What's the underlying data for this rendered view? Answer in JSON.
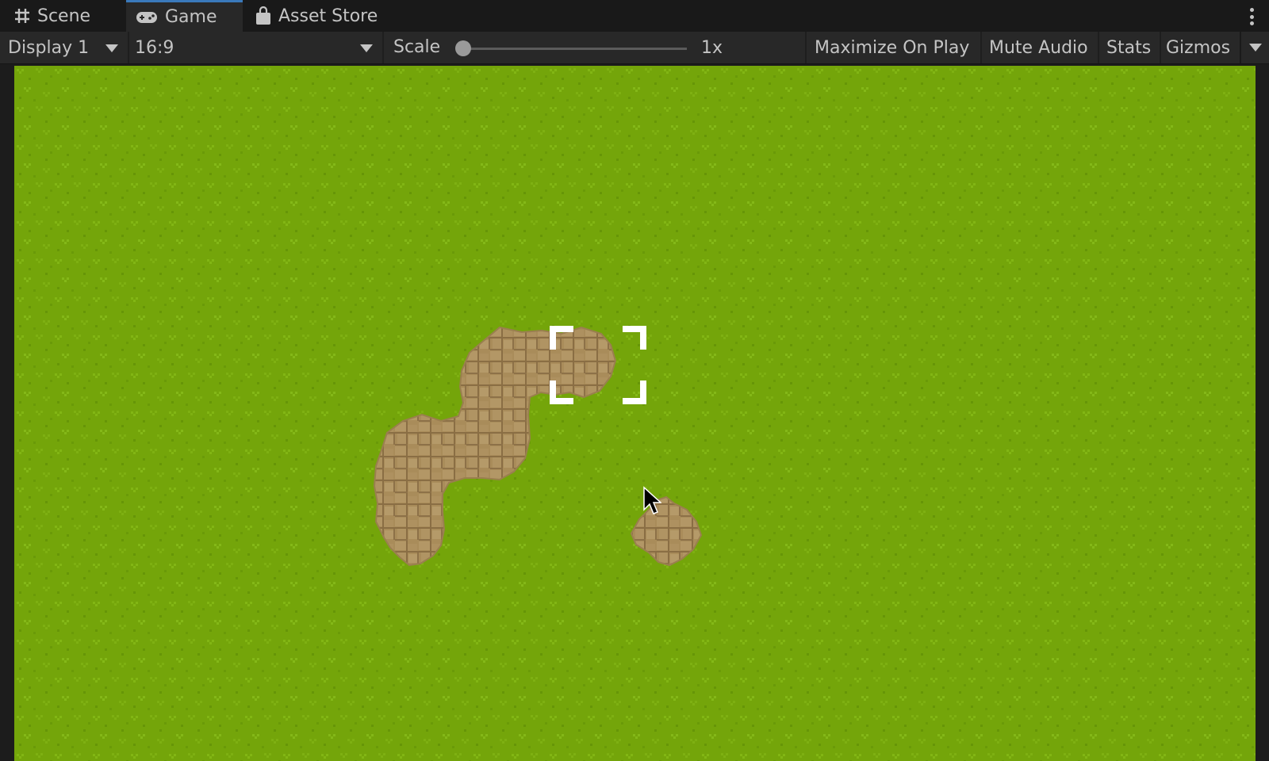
{
  "tabs": [
    {
      "label": "Scene",
      "icon": "grid-hash-icon",
      "active": false
    },
    {
      "label": "Game",
      "icon": "gamepad-icon",
      "active": true
    },
    {
      "label": "Asset Store",
      "icon": "shopping-bag-icon",
      "active": false
    }
  ],
  "tab_menu_icon": "kebab-menu-icon",
  "toolbar": {
    "display": {
      "value": "Display 1"
    },
    "aspect": {
      "value": "16:9"
    },
    "scale": {
      "label": "Scale",
      "value_label": "1x",
      "slider_fraction": 0.0
    },
    "maximize_on_play": "Maximize On Play",
    "mute_audio": "Mute Audio",
    "stats": "Stats",
    "gizmos": "Gizmos"
  },
  "game_view": {
    "terrain": "grass",
    "features": [
      "dirt-patch-large",
      "dirt-patch-small"
    ],
    "selection": "focus-brackets",
    "pointer": "arrow-cursor"
  },
  "colors": {
    "active_tab_accent": "#3a79bb",
    "grass": "#74a50a",
    "dirt": "#a98c5a",
    "panel": "#282828",
    "text": "#c4c4c4"
  }
}
